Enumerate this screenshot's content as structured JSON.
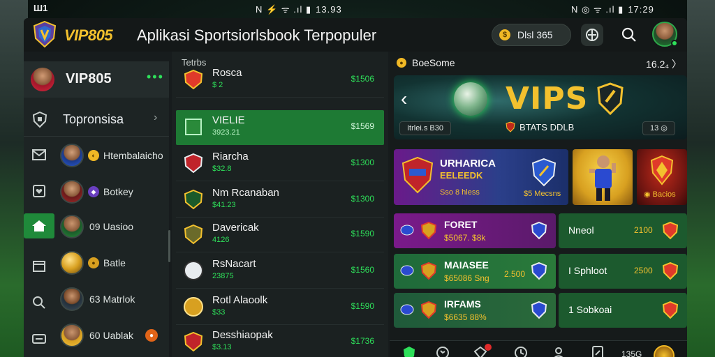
{
  "statusbar": {
    "left": "Ш1",
    "mid": "N ⚡ ᯤ .ıl ▮",
    "mid_time": "13.93",
    "right": "N ◎ ᯤ .ıl ▮",
    "right_time": "17:29"
  },
  "topbar": {
    "brand": "VIP805",
    "title": "Aplikasi Sportsiorlsbook Terpopuler",
    "balance": "Dlsl 365"
  },
  "sidebar": {
    "user_name": "VIP805",
    "promo_label": "Topronsisa",
    "players": [
      {
        "label": "Htembalaicho",
        "coin": "◐"
      },
      {
        "label": "Botkey",
        "coin": "◆"
      },
      {
        "label": "09 Uasioo",
        "coin": ""
      },
      {
        "label": "Batle",
        "coin": ""
      },
      {
        "label": "63 Matrlok",
        "coin": ""
      },
      {
        "label": "60 Uablak",
        "coin": ""
      }
    ]
  },
  "middle": {
    "header": "Tetrbs",
    "rows": [
      {
        "title": "Rosca",
        "sub": "$ 2",
        "value": "$1506"
      },
      {
        "title": "VIELIE",
        "sub": "3923.21",
        "value": "$1569"
      },
      {
        "title": "Riarcha",
        "sub": "$32.8",
        "value": "$1300"
      },
      {
        "title": "Nm Rcanaban",
        "sub": "$41.23",
        "value": "$1300"
      },
      {
        "title": "Davericak",
        "sub": "4126",
        "value": "$1590"
      },
      {
        "title": "RsNacart",
        "sub": "23875",
        "value": "$1560"
      },
      {
        "title": "Rotl Alaoolk",
        "sub": "$33",
        "value": "$1590"
      },
      {
        "title": "Desshiaopak",
        "sub": "$3.13",
        "value": "$1736"
      }
    ]
  },
  "right": {
    "header": "BoeSome",
    "header_right": "16.2₄ 〉",
    "hero": {
      "title": "VIPS",
      "stats": "BTATS DDLB",
      "pill_left": "Itrlei.s B30",
      "pill_right": "13 ◎"
    },
    "promo_a": {
      "t1": "URHARICA",
      "t2": "EELEEDK",
      "t3": "Sso 8 hless",
      "t4": "$5 Mecsns"
    },
    "promo_c": {
      "t": "◉ Bacios"
    },
    "bet_rows": [
      {
        "t1": "FORET",
        "t2": "$5067. $8k",
        "amt": "",
        "label": "Nneol",
        "val": "2100"
      },
      {
        "t1": "MAIASEE",
        "t2": "$65086 Sng",
        "amt": "2.500",
        "label": "I Sphloot",
        "val": "2500"
      },
      {
        "t1": "IRFAMS",
        "t2": "$6635 88%",
        "amt": "",
        "label": "1 Sobkoai",
        "val": ""
      }
    ],
    "bottom_nav": {
      "labels": [
        "",
        "",
        "",
        "",
        "",
        ""
      ],
      "balance": "135G"
    }
  },
  "colors": {
    "accent_green": "#2ee05a",
    "active_green": "#1e7a34",
    "gold": "#f3c12e",
    "panel": "#1b2121"
  }
}
